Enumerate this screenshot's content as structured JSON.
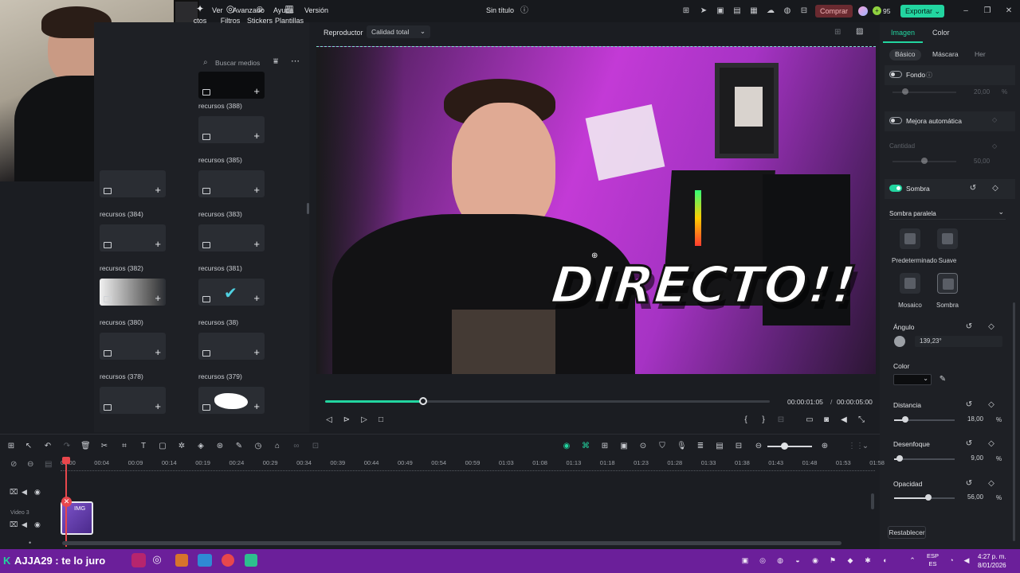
{
  "window": {
    "title": "Sin título"
  },
  "menu": {
    "items": [
      "Ver",
      "Avanzado",
      "Ayuda",
      "Versión"
    ]
  },
  "topbar": {
    "buy_label": "Comprar",
    "credits": "95",
    "export_label": "Exportar"
  },
  "library": {
    "tabs": [
      "ctos",
      "Filtros",
      "Stickers",
      "Plantillas"
    ],
    "search_placeholder": "Buscar medios",
    "items": [
      "recursos (388)",
      "recursos (385)",
      "recursos (384)",
      "recursos (383)",
      "recursos (382)",
      "recursos (381)",
      "recursos (380)",
      "recursos (38)",
      "recursos (378)",
      "recursos (379)"
    ]
  },
  "player": {
    "title": "Reproductor",
    "quality": "Calidad total",
    "overlay_text": "DIRECTO!!",
    "current_time": "00:00:01:05",
    "total_time": "00:00:05:00",
    "progress": 0.22
  },
  "panel": {
    "tabs": [
      "Imagen",
      "Color"
    ],
    "subtabs": [
      "Básico",
      "Máscara",
      "Her"
    ],
    "fondo": {
      "label": "Fondo",
      "value": "20,00",
      "enabled": false
    },
    "mejora": {
      "label": "Mejora automática",
      "cantidad_label": "Cantidad",
      "value": "50,00",
      "enabled": false
    },
    "sombra": {
      "label": "Sombra",
      "enabled": true,
      "type": "Sombra paralela"
    },
    "presets": [
      "Predeterminado",
      "Suave",
      "Mosaico",
      "Sombra"
    ],
    "angulo": {
      "label": "Ángulo",
      "value": "139,23°"
    },
    "color": {
      "label": "Color"
    },
    "distancia": {
      "label": "Distancia",
      "value": "18,00",
      "unit": "%",
      "level": 0.18
    },
    "desenfoque": {
      "label": "Desenfoque",
      "value": "9,00",
      "unit": "%",
      "level": 0.09
    },
    "opacidad": {
      "label": "Opacidad",
      "value": "56,00",
      "unit": "%",
      "level": 0.56
    },
    "reset_label": "Restablecer"
  },
  "timeline": {
    "ruler": [
      "00:00",
      "00:04",
      "00:09",
      "00:14",
      "00:19",
      "00:24",
      "00:29",
      "00:34",
      "00:39",
      "00:44",
      "00:49",
      "00:54",
      "00:59",
      "01:03",
      "01:08",
      "01:13",
      "01:18",
      "01:23",
      "01:28",
      "01:33",
      "01:38",
      "01:43",
      "01:48",
      "01:53",
      "01:58"
    ],
    "track_name": "Video 3",
    "clip_label": "IMG"
  },
  "taskbar": {
    "stream_text": "AJJA29 : te lo juro",
    "lang_top": "ESP",
    "lang_bottom": "ES",
    "time": "4:27 p. m.",
    "date": "8/01/2026"
  },
  "colors": {
    "accent": "#22d5a0",
    "taskbar": "#6b1f9a",
    "playhead": "#e8474c"
  }
}
